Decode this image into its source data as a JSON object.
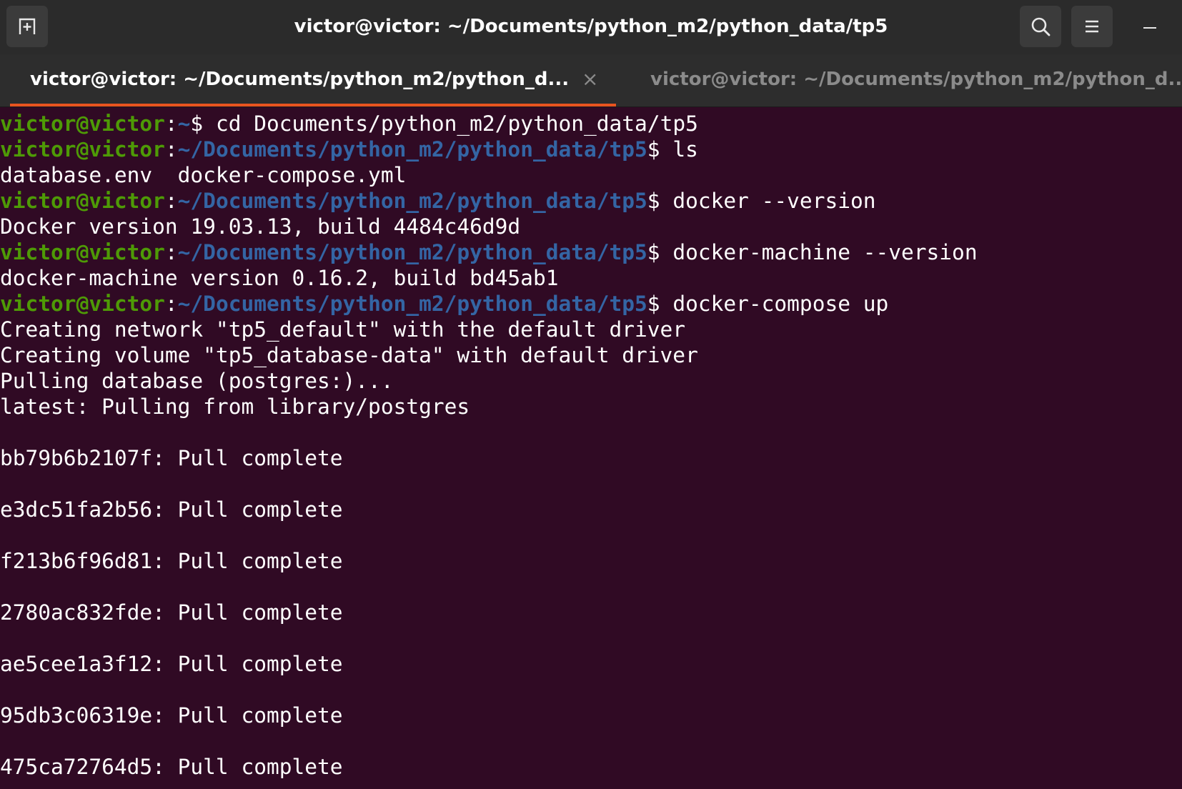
{
  "window": {
    "title": "victor@victor: ~/Documents/python_m2/python_data/tp5",
    "new_tab_icon": "new-tab-icon",
    "search_icon": "search-icon",
    "menu_icon": "hamburger-menu-icon",
    "minimize_icon": "minimize-icon"
  },
  "tabs": [
    {
      "label": "victor@victor: ~/Documents/python_m2/python_d...",
      "active": true,
      "close": "×"
    },
    {
      "label": "victor@victor: ~/Documents/python_m2/python_d...",
      "active": false
    }
  ],
  "colors": {
    "background": "#300a24",
    "prompt_user": "#4e9a06",
    "prompt_path": "#3465a4",
    "text": "#ffffff",
    "tab_accent": "#e95420"
  },
  "terminal": {
    "prompts": [
      {
        "user": "victor@victor",
        "path": "~",
        "command": "cd Documents/python_m2/python_data/tp5"
      },
      {
        "user": "victor@victor",
        "path": "~/Documents/python_m2/python_data/tp5",
        "command": "ls"
      },
      {
        "user": "victor@victor",
        "path": "~/Documents/python_m2/python_data/tp5",
        "command": "docker --version"
      },
      {
        "user": "victor@victor",
        "path": "~/Documents/python_m2/python_data/tp5",
        "command": "docker-machine --version"
      },
      {
        "user": "victor@victor",
        "path": "~/Documents/python_m2/python_data/tp5",
        "command": "docker-compose up"
      }
    ],
    "outputs": {
      "ls": "database.env  docker-compose.yml",
      "docker_version": "Docker version 19.03.13, build 4484c46d9d",
      "docker_machine_version": "docker-machine version 0.16.2, build bd45ab1",
      "compose": [
        "Creating network \"tp5_default\" with the default driver",
        "Creating volume \"tp5_database-data\" with default driver",
        "Pulling database (postgres:)...",
        "latest: Pulling from library/postgres"
      ],
      "pulls": [
        "bb79b6b2107f: Pull complete",
        "e3dc51fa2b56: Pull complete",
        "f213b6f96d81: Pull complete",
        "2780ac832fde: Pull complete",
        "ae5cee1a3f12: Pull complete",
        "95db3c06319e: Pull complete",
        "475ca72764d5: Pull complete"
      ]
    }
  }
}
